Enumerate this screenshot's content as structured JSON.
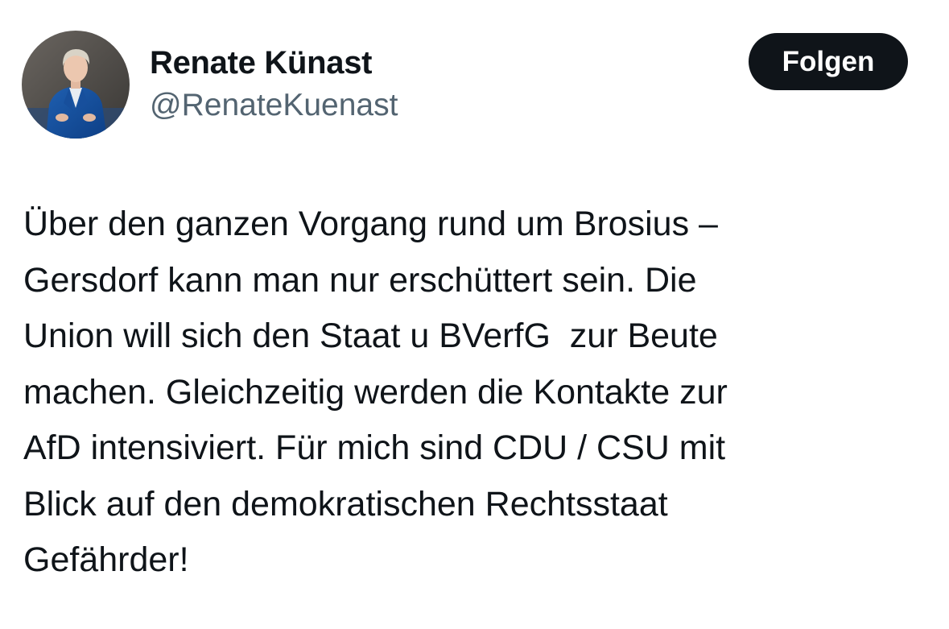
{
  "author": {
    "display_name": "Renate Künast",
    "handle": "@RenateKuenast",
    "avatar_icon": "profile-photo"
  },
  "follow_button": {
    "label": "Folgen"
  },
  "tweet": {
    "lines": [
      "Über den ganzen Vorgang rund um Brosius –",
      "Gersdorf kann man nur erschüttert sein. Die",
      "Union will sich den Staat u BVerfG  zur Beute",
      "machen. Gleichzeitig werden die Kontakte zur",
      "AfD intensiviert. Für mich sind CDU / CSU mit",
      "Blick auf den demokratischen Rechtsstaat",
      "Gefährder!"
    ]
  },
  "colors": {
    "text": "#0f1419",
    "secondary_text": "#536471",
    "button_bg": "#0f1419",
    "button_text": "#ffffff",
    "background": "#ffffff"
  }
}
